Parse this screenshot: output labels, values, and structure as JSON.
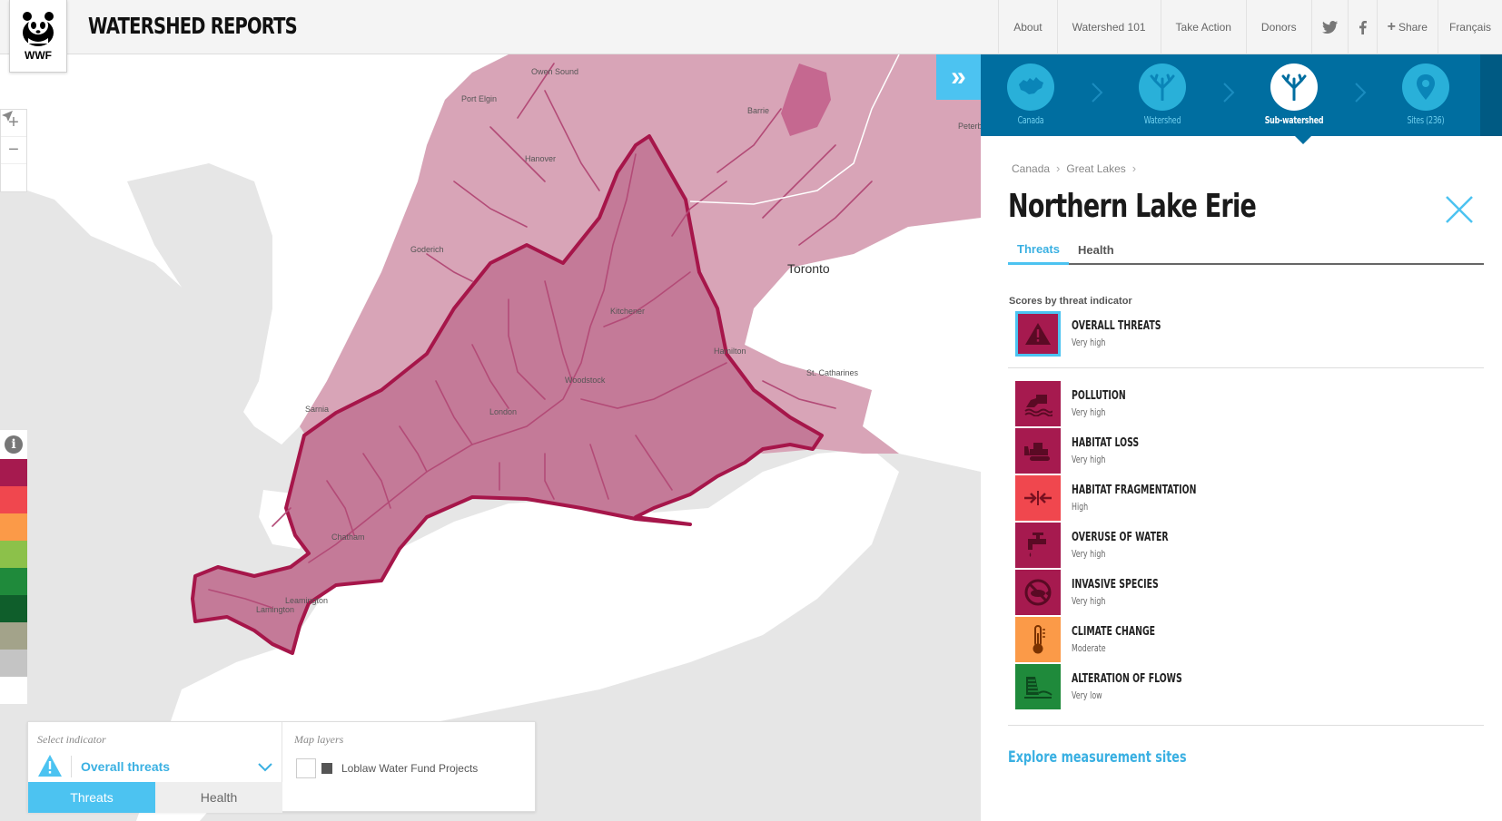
{
  "header": {
    "logo_text": "WWF",
    "title": "WATERSHED REPORTS",
    "nav": {
      "about": "About",
      "watershed101": "Watershed 101",
      "take_action": "Take Action",
      "donors": "Donors",
      "share": "Share",
      "language": "Français"
    }
  },
  "map": {
    "places": [
      "Owen Sound",
      "Port Elgin",
      "Barrie",
      "Hanover",
      "Peterb",
      "Goderich",
      "Toronto",
      "Kitchener",
      "Hamilton",
      "St. Catharines",
      "Woodstock",
      "Sarnia",
      "London",
      "Chatham",
      "Leamington",
      "Lamington"
    ],
    "colors": {
      "outer_watershed": "#d8a4b7",
      "subwatershed_fill": "#c47a98",
      "subwatershed_outline": "#a6164a",
      "river": "#b34b77",
      "water": "#ffffff",
      "land": "#e6e6e6"
    },
    "legend_colors": [
      "#a61a4f",
      "#f0474e",
      "#fb9a48",
      "#8cc14a",
      "#1f8a3b",
      "#0f5e2b",
      "#a3a38a",
      "#c4c4c4",
      "#ffffff"
    ],
    "expand_icon": "double-chevron-right-icon"
  },
  "indicator_panel": {
    "select_label": "Select indicator",
    "selected_value": "Overall threats",
    "tabs": [
      "Threats",
      "Health"
    ],
    "layers_label": "Map layers",
    "layer_item": "Loblaw Water Fund Projects"
  },
  "panel": {
    "steps": [
      {
        "label": "Canada",
        "icon": "canada-map-icon"
      },
      {
        "label": "Watershed",
        "icon": "watershed-tree-icon"
      },
      {
        "label": "Sub-watershed",
        "icon": "subwatershed-tree-icon",
        "active": true
      },
      {
        "label": "Sites (236)",
        "icon": "map-pin-icon"
      }
    ],
    "breadcrumb": [
      "Canada",
      "Great Lakes"
    ],
    "title": "Northern Lake Erie",
    "tabs": [
      "Threats",
      "Health"
    ],
    "scores_heading": "Scores by threat indicator",
    "overall": {
      "name": "OVERALL THREATS",
      "level": "Very high",
      "color": "#a61a4f",
      "icon": "warning-icon"
    },
    "threats": [
      {
        "name": "POLLUTION",
        "level": "Very high",
        "color": "#a61a4f",
        "icon": "pollution-icon"
      },
      {
        "name": "HABITAT LOSS",
        "level": "Very high",
        "color": "#a61a4f",
        "icon": "bulldozer-icon"
      },
      {
        "name": "HABITAT FRAGMENTATION",
        "level": "High",
        "color": "#f0474e",
        "icon": "fragmentation-icon"
      },
      {
        "name": "OVERUSE OF WATER",
        "level": "Very high",
        "color": "#a61a4f",
        "icon": "faucet-icon"
      },
      {
        "name": "INVASIVE SPECIES",
        "level": "Very high",
        "color": "#a61a4f",
        "icon": "invasive-species-icon"
      },
      {
        "name": "CLIMATE CHANGE",
        "level": "Moderate",
        "color": "#fb9a48",
        "icon": "thermometer-icon"
      },
      {
        "name": "ALTERATION OF FLOWS",
        "level": "Very low",
        "color": "#1f8a3b",
        "icon": "dam-icon"
      }
    ],
    "explore_link": "Explore measurement sites"
  }
}
